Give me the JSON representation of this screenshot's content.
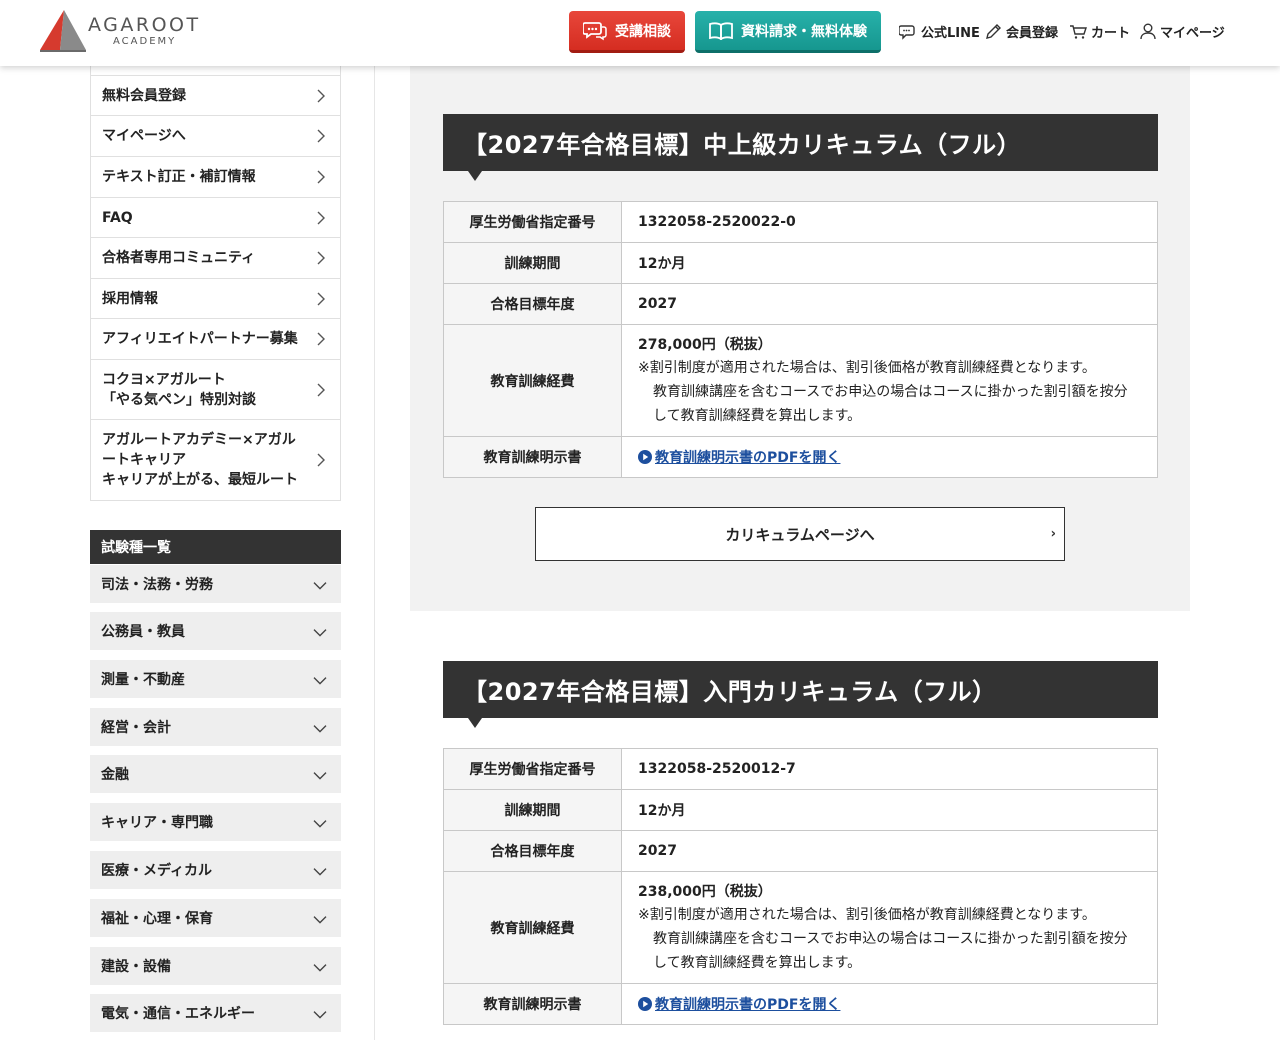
{
  "header": {
    "logo_word": "AGAROOT",
    "logo_sub": "ACADEMY",
    "consult_label": "受講相談",
    "request_label": "資料請求・無料体験",
    "nav": [
      {
        "label": "公式LINE",
        "icon": "chat-bubble-icon"
      },
      {
        "label": "会員登録",
        "icon": "pencil-icon"
      },
      {
        "label": "カート",
        "icon": "cart-icon"
      },
      {
        "label": "マイページ",
        "icon": "user-icon"
      }
    ]
  },
  "sidebar": {
    "menu": [
      {
        "label": "無料会員登録"
      },
      {
        "label": "マイページへ"
      },
      {
        "label": "テキスト訂正・補訂情報"
      },
      {
        "label": "FAQ"
      },
      {
        "label": "合格者専用コミュニティ"
      },
      {
        "label": "採用情報"
      },
      {
        "label": "アフィリエイトパートナー募集"
      },
      {
        "label_lines": [
          "コクヨ×アガルート",
          "「やる気ペン」特別対談"
        ]
      },
      {
        "label_lines": [
          "アガルートアカデミー×アガル",
          "ートキャリア",
          "キャリアが上がる、最短ルート"
        ]
      }
    ],
    "exam_heading": "試験種一覧",
    "exams": [
      "司法・法務・労務",
      "公務員・教員",
      "測量・不動産",
      "経営・会計",
      "金融",
      "キャリア・専門職",
      "医療・メディカル",
      "福祉・心理・保育",
      "建設・設備",
      "電気・通信・エネルギー"
    ]
  },
  "courses": [
    {
      "title": "【2027年合格目標】中上級カリキュラム（フル）",
      "rows": {
        "designation_label": "厚生労働省指定番号",
        "designation_value": "1322058-2520022-0",
        "period_label": "訓練期間",
        "period_value": "12か月",
        "year_label": "合格目標年度",
        "year_value": "2027",
        "cost_label": "教育訓練経費",
        "cost_value": "278,000円（税抜）",
        "cost_note_1": "※割引制度が適用された場合は、割引後価格が教育訓練経費となります。",
        "cost_note_2": "教育訓練講座を含むコースでお申込の場合はコースに掛かった割引額を按分",
        "cost_note_3": "して教育訓練経費を算出します。",
        "doc_label": "教育訓練明示書",
        "doc_link": "教育訓練明示書のPDFを開く"
      },
      "curriculum_button": "カリキュラムページへ"
    },
    {
      "title": "【2027年合格目標】入門カリキュラム（フル）",
      "rows": {
        "designation_label": "厚生労働省指定番号",
        "designation_value": "1322058-2520012-7",
        "period_label": "訓練期間",
        "period_value": "12か月",
        "year_label": "合格目標年度",
        "year_value": "2027",
        "cost_label": "教育訓練経費",
        "cost_value": "238,000円（税抜）",
        "cost_note_1": "※割引制度が適用された場合は、割引後価格が教育訓練経費となります。",
        "cost_note_2": "教育訓練講座を含むコースでお申込の場合はコースに掛かった割引額を按分",
        "cost_note_3": "して教育訓練経費を算出します。",
        "doc_label": "教育訓練明示書",
        "doc_link": "教育訓練明示書のPDFを開く"
      }
    }
  ],
  "colors": {
    "consult_red": "#d9352a",
    "request_teal": "#1fa39c",
    "dark_header": "#333333",
    "link_blue": "#1d4f9e"
  }
}
